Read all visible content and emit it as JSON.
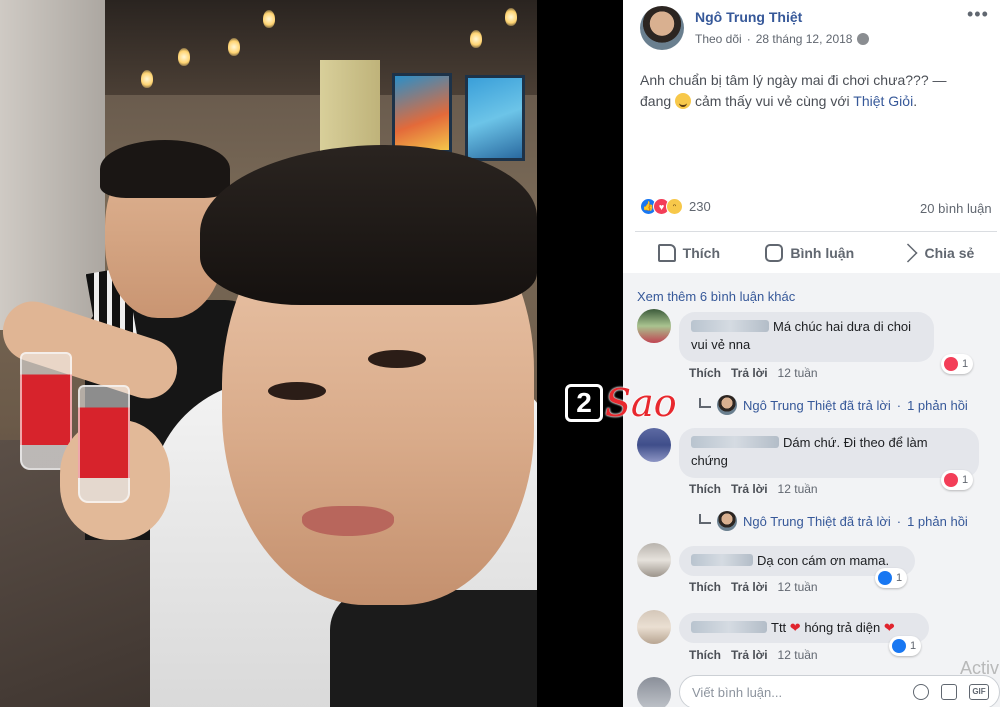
{
  "post": {
    "author": "Ngô Trung Thiệt",
    "follow": "Theo dõi",
    "dot": "·",
    "date": "28 tháng 12, 2018",
    "text_main": "Anh chuẩn bị tâm lý ngày mai đi chơi chưa??? —",
    "text_feeling_prefix": "đang",
    "text_feeling": "cảm thấy vui vẻ cùng với",
    "tagged": "Thiệt Giỏi",
    "tagged_end": ".",
    "reaction_count": "230",
    "comment_count": "20 bình luận"
  },
  "actions": {
    "like": "Thích",
    "comment": "Bình luận",
    "share": "Chia sẻ"
  },
  "see_more": "Xem thêm 6 bình luận khác",
  "comments": [
    {
      "text": "Má chúc hai dưa di choi vui vẻ nna",
      "reactions": "1",
      "reaction_type": "love",
      "reply_action": "Thích",
      "reply": "Trả lời",
      "time": "12 tuần",
      "replied_by": "Ngô Trung Thiệt đã trả lời",
      "replies": "1 phản hồi"
    },
    {
      "text": "Dám chứ. Đi theo để làm chứng",
      "reactions": "1",
      "reaction_type": "love",
      "reply_action": "Thích",
      "reply": "Trả lời",
      "time": "12 tuần",
      "replied_by": "Ngô Trung Thiệt đã trả lời",
      "replies": "1 phản hồi"
    },
    {
      "text": "Dạ con cám ơn mama.",
      "reactions": "1",
      "reaction_type": "like",
      "reply_action": "Thích",
      "reply": "Trả lời",
      "time": "12 tuần"
    },
    {
      "text_a": "Ttt",
      "text_b": "hóng trả diện",
      "reactions": "1",
      "reaction_type": "like",
      "reply_action": "Thích",
      "reply": "Trả lời",
      "time": "12 tuần"
    }
  ],
  "write_placeholder": "Viết bình luận...",
  "watermark": {
    "box": "2",
    "text": "Sao"
  },
  "overlay": "Activ",
  "colors": {
    "link": "#365899",
    "like": "#1877f2",
    "love": "#f33e58",
    "watermark": "#e8282e"
  },
  "icons": [
    "more-icon",
    "globe-icon",
    "like-icon",
    "comment-icon",
    "share-icon",
    "emoji-icon",
    "camera-icon",
    "gif-icon",
    "sticker-icon"
  ]
}
